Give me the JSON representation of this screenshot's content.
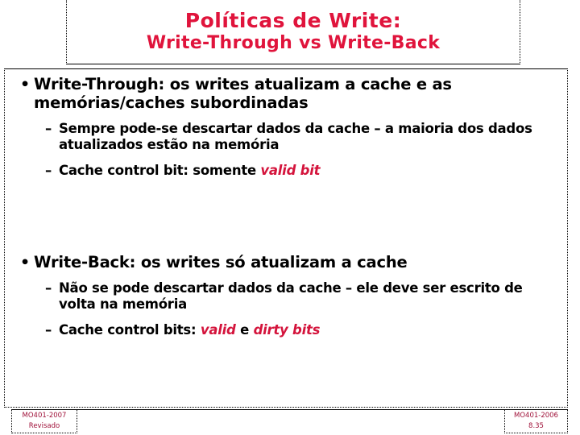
{
  "slide": {
    "title": {
      "line1": "Políticas de Write:",
      "line2": "Write-Through vs Write-Back",
      "color": "#E0143C"
    },
    "bullet_marker": "•",
    "dash_marker": "–",
    "sections": [
      {
        "id": "write-through",
        "heading": "Write-Through: os writes atualizam a cache e as memórias/caches subordinadas",
        "sub_items": [
          {
            "text": "Sempre pode-se descartar dados da cache – a maioria dos dados atualizados estão na memória",
            "emphasis": ""
          },
          {
            "text_before": "Cache control bit: somente ",
            "emphasis": "valid bit",
            "text_after": ""
          }
        ]
      },
      {
        "id": "write-back",
        "heading": "Write-Back: os writes só atualizam a cache",
        "sub_items": [
          {
            "text": "Não se pode descartar dados da  cache – ele deve ser escrito de volta na memória",
            "emphasis": ""
          },
          {
            "text_before": "Cache control bits: ",
            "emphasis": "valid",
            "text_middle": " e ",
            "emphasis2": "dirty bits",
            "text_after": ""
          }
        ]
      }
    ],
    "footer": {
      "left_line1": "MO401-2007",
      "left_line2": "Revisado",
      "right_line1": "MO401-2006",
      "right_line2": "8.35",
      "color": "#A0123A"
    },
    "emphasis_color": "#D4143C",
    "text_color": "#000000",
    "background_color": "#FFFFFF"
  }
}
